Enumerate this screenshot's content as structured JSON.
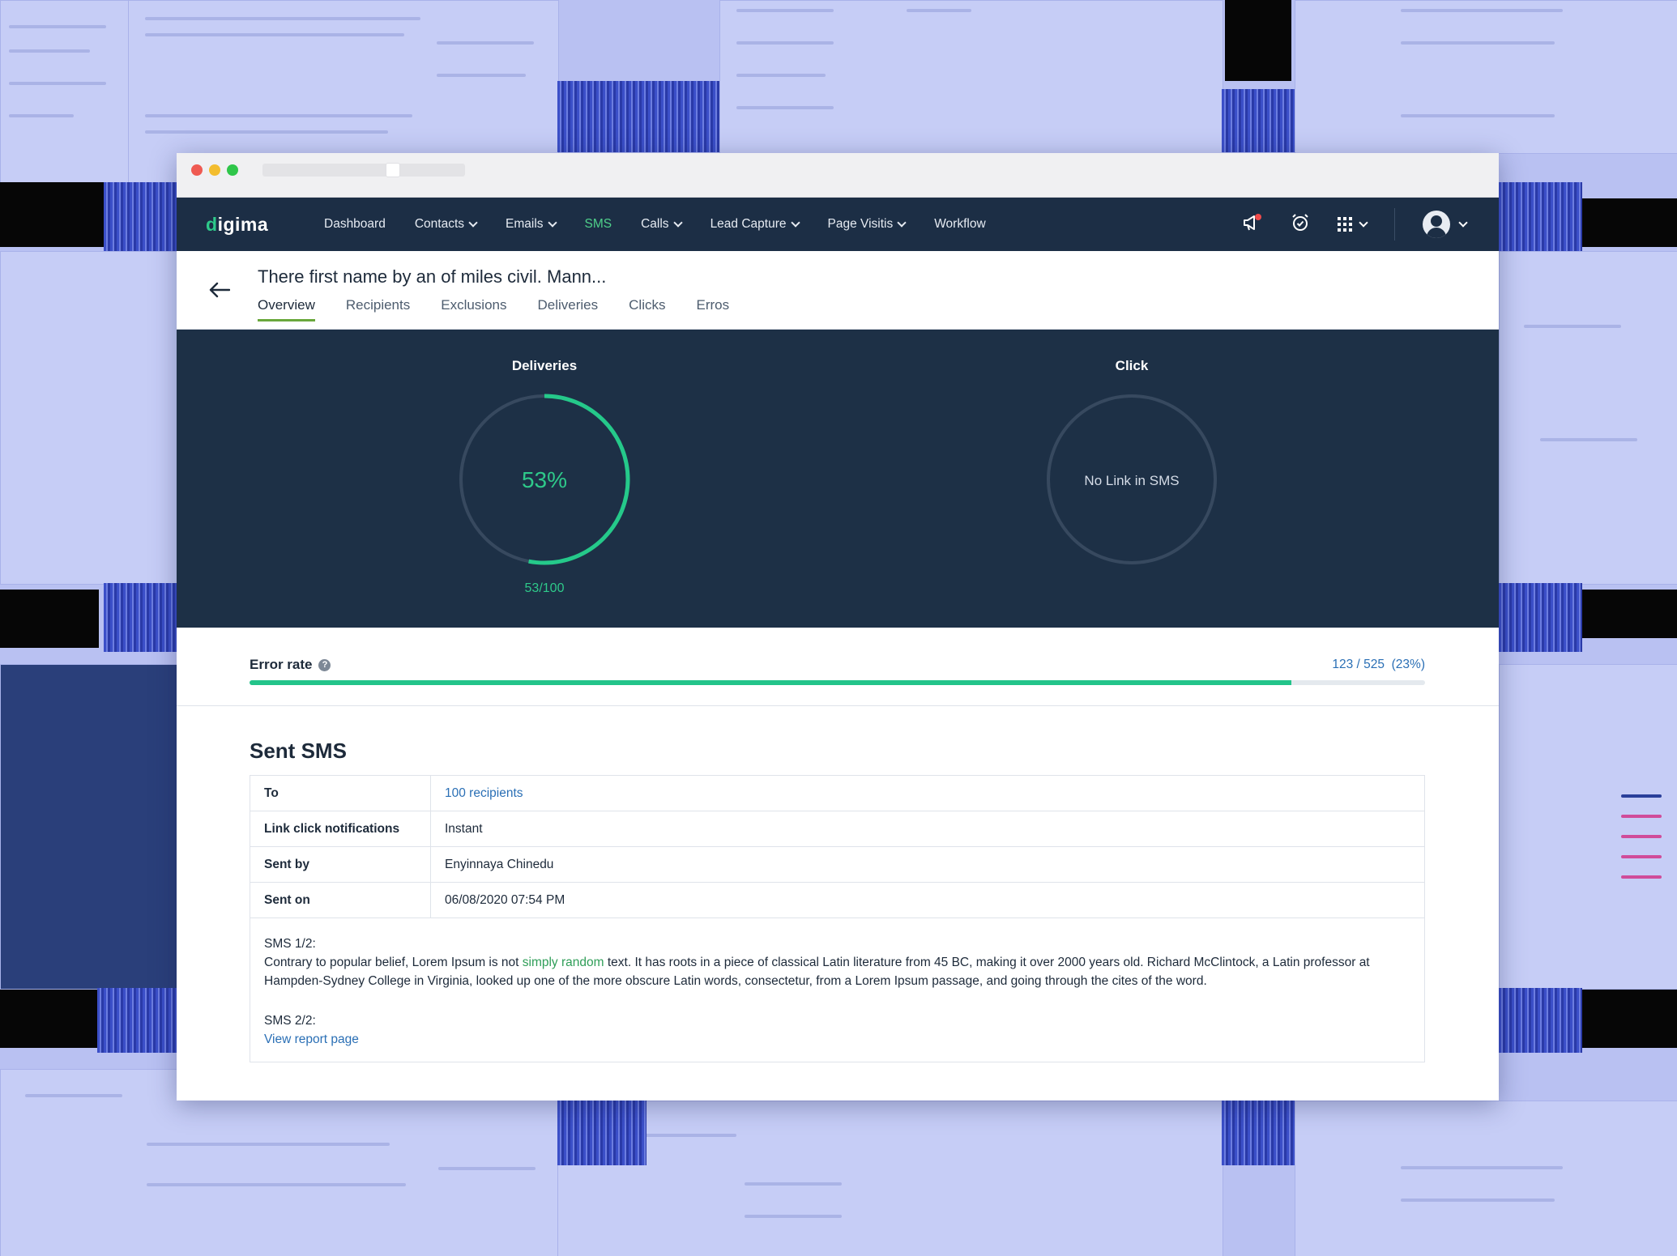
{
  "app": {
    "brand_prefix": "d",
    "brand_rest": "igima"
  },
  "nav": {
    "items": [
      {
        "label": "Dashboard",
        "dropdown": false
      },
      {
        "label": "Contacts",
        "dropdown": true
      },
      {
        "label": "Emails",
        "dropdown": true
      },
      {
        "label": "SMS",
        "dropdown": false,
        "active": true
      },
      {
        "label": "Calls",
        "dropdown": true
      },
      {
        "label": "Lead Capture",
        "dropdown": true
      },
      {
        "label": "Page Visitis",
        "dropdown": true
      },
      {
        "label": "Workflow",
        "dropdown": false
      }
    ],
    "icons": [
      "megaphone-icon",
      "alarm-clock-icon",
      "apps-grid-icon",
      "avatar"
    ]
  },
  "page": {
    "title": "There first name by an of miles civil. Mann...",
    "tabs": [
      "Overview",
      "Recipients",
      "Exclusions",
      "Deliveries",
      "Clicks",
      "Erros"
    ],
    "active_tab": "Overview"
  },
  "stats": {
    "deliveries": {
      "title": "Deliveries",
      "percent_label": "53%",
      "fraction_label": "53/100",
      "fraction": 0.53
    },
    "click": {
      "title": "Click",
      "center_label": "No Link in SMS"
    }
  },
  "error_rate": {
    "label": "Error rate",
    "value": "123 / 525  (23%)",
    "bar_fill_fraction": 0.886
  },
  "sent_sms": {
    "title": "Sent SMS",
    "rows": [
      {
        "key": "To",
        "value": "100 recipients",
        "is_link": true
      },
      {
        "key": "Link click notifications",
        "value": "Instant"
      },
      {
        "key": "Sent by",
        "value": "Enyinnaya Chinedu"
      },
      {
        "key": "Sent on",
        "value": "06/08/2020 07:54 PM"
      }
    ],
    "sms1_label": "SMS 1/2:",
    "sms1_before": "Contrary to popular belief, Lorem Ipsum is not ",
    "sms1_highlight": "simply random",
    "sms1_after": " text. It has roots in a piece of classical Latin literature from 45 BC, making it over 2000 years old. Richard McClintock, a Latin professor at Hampden-Sydney College in Virginia, looked up one of the more obscure Latin words, consectetur, from a Lorem Ipsum passage, and going through the cites of the word.",
    "sms2_label": "SMS 2/2:",
    "sms2_link": "View report page"
  },
  "colors": {
    "nav_bg": "#1c2e45",
    "stats_bg": "#1d3046",
    "accent_green": "#2ec98a",
    "link_blue": "#2a6fb5",
    "tab_underline": "#6aa83c"
  }
}
